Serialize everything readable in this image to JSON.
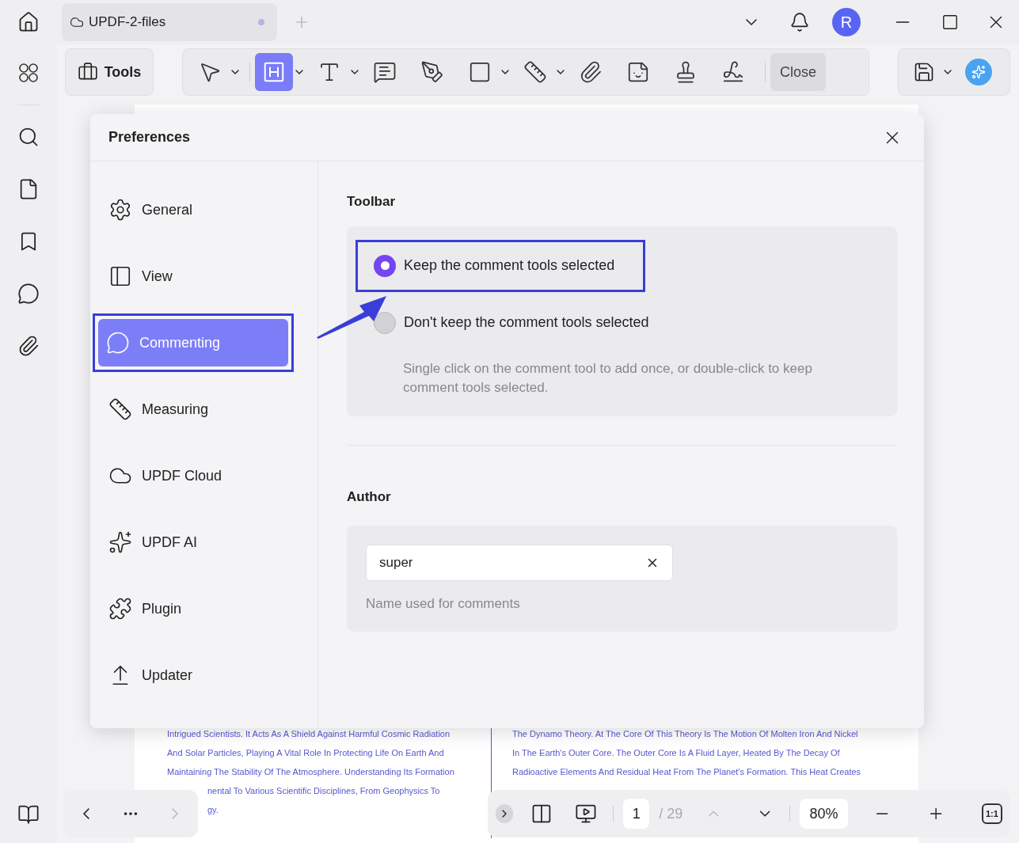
{
  "tab": {
    "title": "UPDF-2-files"
  },
  "account": {
    "initial": "R"
  },
  "toolbar": {
    "tools_label": "Tools",
    "close_label": "Close",
    "tools": [
      {
        "selected": false,
        "dropdown": true
      },
      {
        "selected": true,
        "dropdown": true
      },
      {
        "selected": false,
        "dropdown": true
      },
      {
        "selected": false,
        "dropdown": false
      },
      {
        "selected": false,
        "dropdown": false
      },
      {
        "selected": false,
        "dropdown": true
      },
      {
        "selected": false,
        "dropdown": true
      },
      {
        "selected": false,
        "dropdown": false
      },
      {
        "selected": false,
        "dropdown": false
      },
      {
        "selected": false,
        "dropdown": false
      },
      {
        "selected": false,
        "dropdown": false
      }
    ]
  },
  "document": {
    "column_1": [
      "Intrigued Scientists. It Acts As A Shield Against Harmful Cosmic Radiation",
      "And Solar Particles, Playing A Vital Role In Protecting Life On Earth And",
      "Maintaining The Stability Of The Atmosphere. Understanding Its Formation"
    ],
    "column_1_partly_covered": [
      "nental To Various Scientific Disciplines, From Geophysics To",
      "gy."
    ],
    "column_2": [
      "The Dynamo Theory. At The Core Of This Theory Is The Motion Of Molten Iron And Nickel",
      "In The Earth's Outer Core. The Outer Core Is A Fluid Layer, Heated By The Decay Of",
      "Radioactive Elements And Residual Heat From The Planet's Formation. This Heat Creates"
    ]
  },
  "dialog": {
    "title": "Preferences",
    "nav": [
      {
        "label": "General",
        "selected": false,
        "annotated": false
      },
      {
        "label": "View",
        "selected": false,
        "annotated": false
      },
      {
        "label": "Commenting",
        "selected": true,
        "annotated": true
      },
      {
        "label": "Measuring",
        "selected": false,
        "annotated": false
      },
      {
        "label": "UPDF Cloud",
        "selected": false,
        "annotated": false
      },
      {
        "label": "UPDF AI",
        "selected": false,
        "annotated": false
      },
      {
        "label": "Plugin",
        "selected": false,
        "annotated": false
      },
      {
        "label": "Updater",
        "selected": false,
        "annotated": false
      }
    ],
    "toolbar_section": {
      "title": "Toolbar",
      "options": [
        {
          "label": "Keep the comment tools selected",
          "selected": true,
          "annotated": true
        },
        {
          "label": "Don't keep the comment tools selected",
          "selected": false,
          "annotated": false
        }
      ],
      "hint": "Single click on the comment tool to add once, or double-click to keep comment tools selected."
    },
    "author_section": {
      "title": "Author",
      "value": "super",
      "hint": "Name used for comments"
    }
  },
  "page_nav": {
    "current": "1",
    "total": "/ 29",
    "zoom": "80%",
    "actual_size": "1:1"
  }
}
